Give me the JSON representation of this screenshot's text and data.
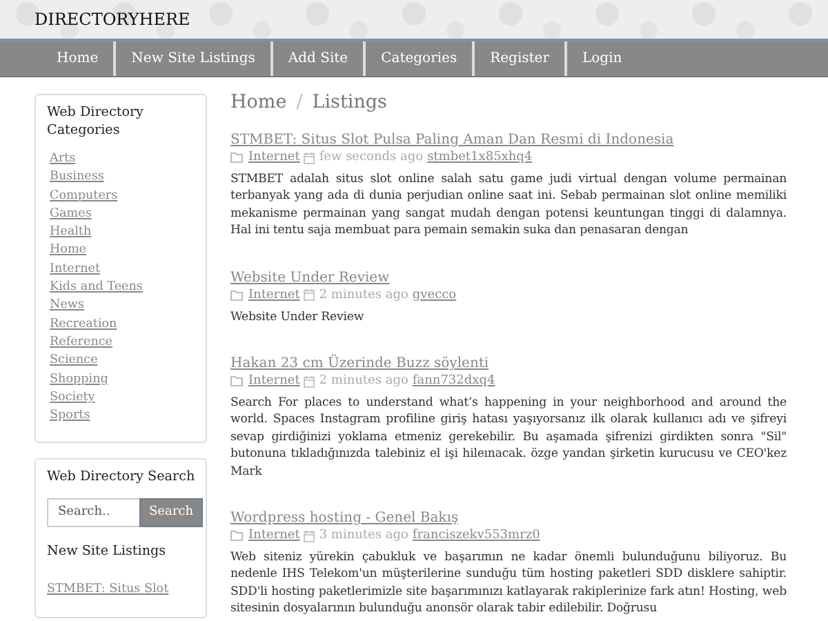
{
  "site": {
    "title": "DIRECTORYHERE"
  },
  "nav": [
    {
      "label": "Home"
    },
    {
      "label": "New Site Listings"
    },
    {
      "label": "Add Site"
    },
    {
      "label": "Categories"
    },
    {
      "label": "Register"
    },
    {
      "label": "Login"
    }
  ],
  "sidebar": {
    "categories": {
      "title": "Web Directory Categories",
      "items": [
        "Arts",
        "Business",
        "Computers",
        "Games",
        "Health",
        "Home",
        "Internet",
        "Kids and Teens",
        "News",
        "Recreation",
        "Reference",
        "Science",
        "Shopping",
        "Society",
        "Sports"
      ]
    },
    "search": {
      "title": "Web Directory Search",
      "placeholder": "Search..",
      "button": "Search"
    },
    "new_listings": {
      "title": "New Site Listings",
      "items": [
        "STMBET: Situs Slot"
      ]
    }
  },
  "breadcrumb": [
    "Home",
    "Listings"
  ],
  "breadcrumb_separator": "/",
  "listings": [
    {
      "title": "STMBET: Situs Slot Pulsa Paling Aman Dan Resmi di Indonesia",
      "category": "Internet",
      "time": "few seconds ago",
      "author": "stmbet1x85xhq4",
      "description": "STMBET adalah situs slot online salah satu game judi virtual dengan volume permainan terbanyak yang ada di dunia perjudian online saat ini. Sebab permainan slot online memiliki mekanisme permainan yang sangat mudah dengan potensi keuntungan tinggi di dalamnya. Hal ini tentu saja membuat para pemain semakin suka dan penasaran dengan"
    },
    {
      "title": "Website Under Review",
      "category": "Internet",
      "time": "2 minutes ago",
      "author": "gvecco",
      "description": "Website Under Review"
    },
    {
      "title": "Hakan 23 cm Üzerinde Buzz söylenti",
      "category": "Internet",
      "time": "2 minutes ago",
      "author": "fann732dxq4",
      "description": "Search For places to understand what’s happening in your neighborhood and around the world. Spaces Instagram profiline giriş hatası yaşıyorsanız ilk olarak kullanıcı adı ve şifreyi sevap girdiğinizi yoklama etmeniz gerekebilir. Bu aşamada şifrenizi girdikten sonra \"Sil\" butonuna tıkladığınızda talebiniz el işi hileınacak. özge yandan şirketin kurucusu ve CEO'kez Mark"
    },
    {
      "title": "Wordpress hosting - Genel Bakış",
      "category": "Internet",
      "time": "3 minutes ago",
      "author": "franciszekv553mrz0",
      "description": "Web siteniz yürekin çabukluk ve başarımın ne kadar önemli bulunduğunu biliyoruz. Bu nedenle IHS Telekom'un müşterilerine sunduğu tüm hosting paketleri SDD disklere sahiptir. SDD'li hosting paketlerimizle site başarımınızı katlayarak rakiplerinize fark atın! Hosting, web sitesinin dosyalarının bulunduğu anonsör olarak tabir edilebilir. Doğrusu"
    }
  ]
}
